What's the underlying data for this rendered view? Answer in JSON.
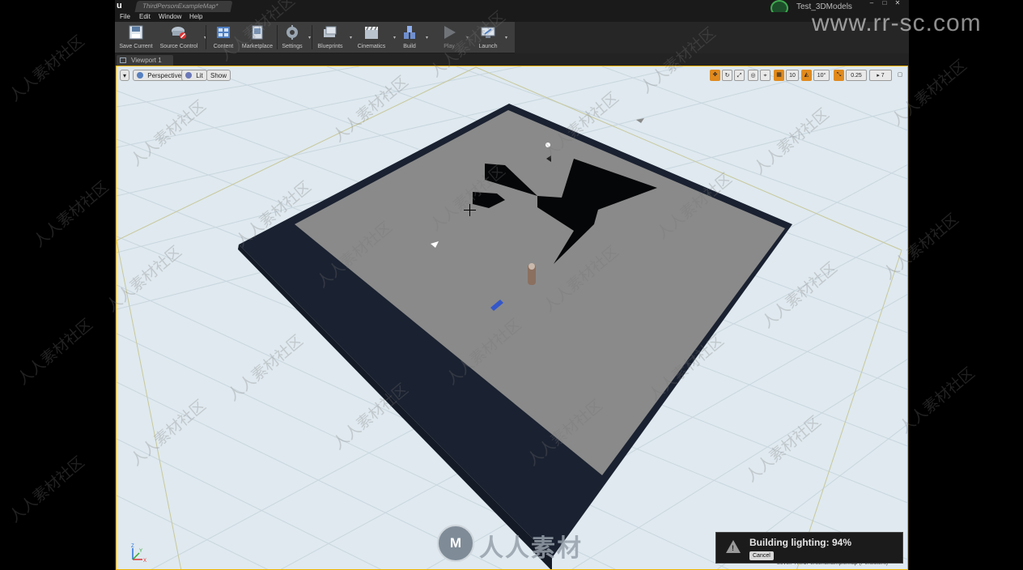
{
  "window": {
    "tab_title": "ThirdPersonExampleMap*",
    "project_name": "Test_3DModels",
    "controls": {
      "minimize": "–",
      "maximize": "□",
      "close": "✕"
    }
  },
  "menu": [
    "File",
    "Edit",
    "Window",
    "Help"
  ],
  "toolbar": [
    {
      "label": "Save Current",
      "icon": "save-icon"
    },
    {
      "label": "Source Control",
      "icon": "source-control-icon"
    },
    {
      "label": "Content",
      "icon": "content-icon"
    },
    {
      "label": "Marketplace",
      "icon": "marketplace-icon"
    },
    {
      "label": "Settings",
      "icon": "settings-icon"
    },
    {
      "label": "Blueprints",
      "icon": "blueprints-icon"
    },
    {
      "label": "Cinematics",
      "icon": "cinematics-icon"
    },
    {
      "label": "Build",
      "icon": "build-icon"
    },
    {
      "label": "Play",
      "icon": "play-icon"
    },
    {
      "label": "Launch",
      "icon": "launch-icon"
    }
  ],
  "viewport": {
    "tab_label": "Viewport 1",
    "view_mode": "Perspective",
    "lighting_mode": "Lit",
    "show_label": "Show",
    "grid_snap_value": "10",
    "rotation_snap_value": "10°",
    "scale_snap_value": "0.25",
    "camera_speed": "7",
    "level_label": "Level:  ThirdPersonExampleMap (Persistent)"
  },
  "notification": {
    "text": "Building lighting:  94%",
    "progress_percent": 94,
    "cancel_label": "Cancel"
  },
  "watermark": {
    "url": "www.rr-sc.com",
    "logo_text": "M",
    "brand": "人人素材",
    "tile_text": "人人素材社区"
  },
  "colors": {
    "accent": "#f0b400",
    "floor_top": "#8a8a8a",
    "floor_border": "#1a2130",
    "sky": "#dfe9ef"
  }
}
